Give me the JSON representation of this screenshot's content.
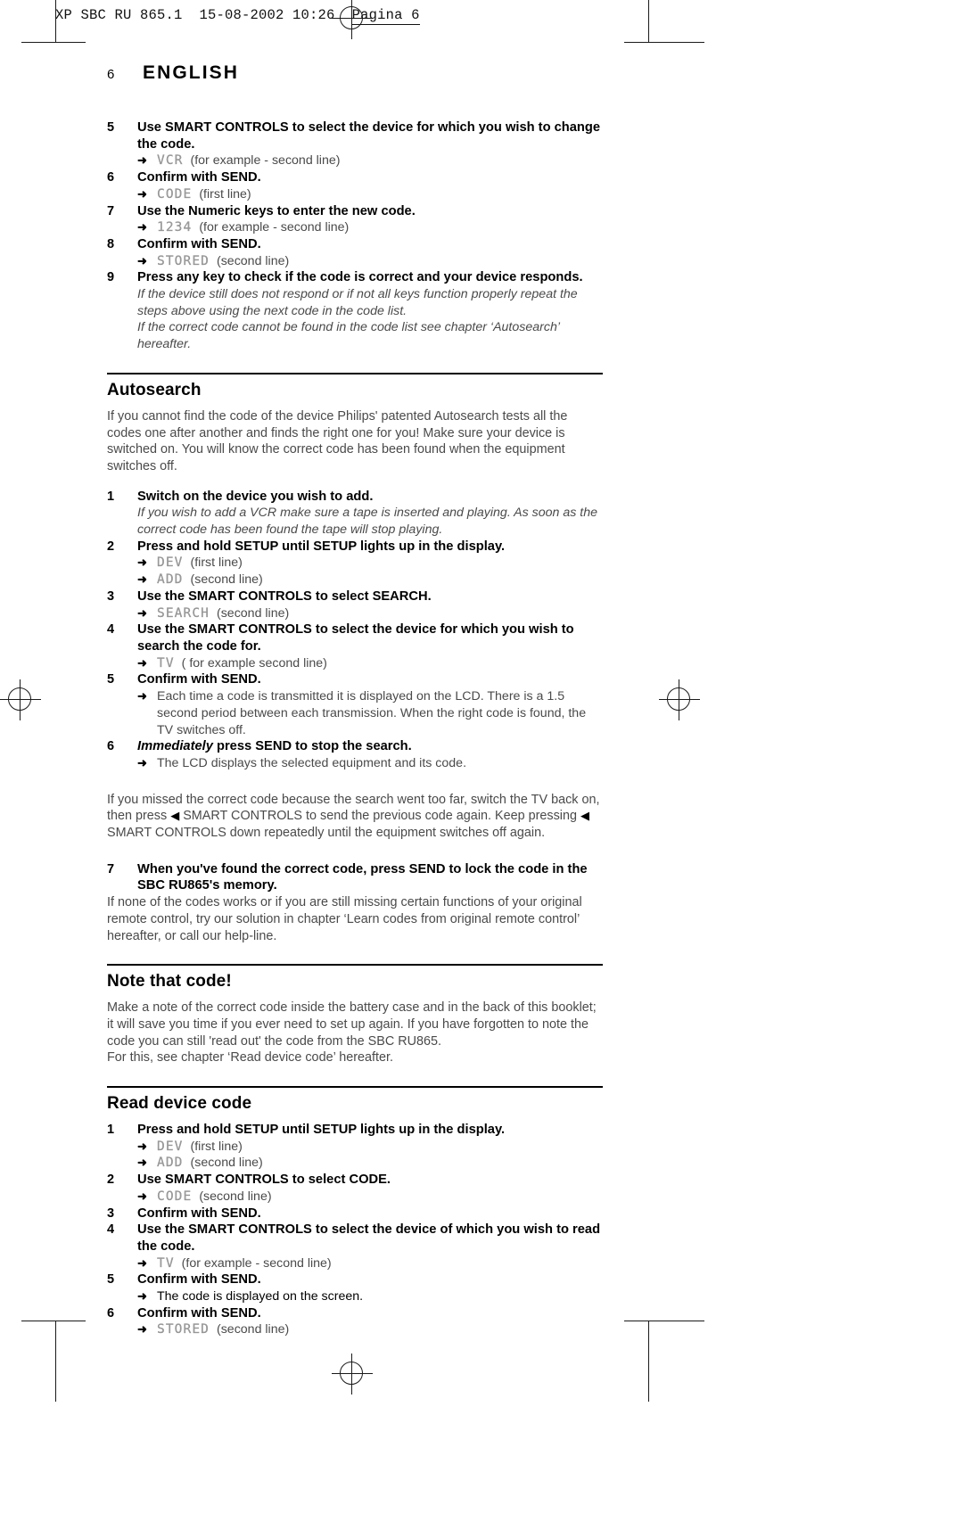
{
  "film_header": {
    "prefix": "XP SBC RU 865.1  15-08-2002 10:26",
    "page_label": "Pagina 6"
  },
  "page_header": {
    "folio": "6",
    "language": "ENGLISH"
  },
  "icons": {
    "arrow_right": "➜",
    "triangle_left": "◀"
  },
  "top_steps": [
    {
      "num": "5",
      "text": "Use SMART CONTROLS to select the device for which you wish to change the code.",
      "subs": [
        {
          "lcd": "VCR",
          "note": "(for example - second line)"
        }
      ]
    },
    {
      "num": "6",
      "text": "Confirm with SEND.",
      "subs": [
        {
          "lcd": "CODE",
          "note": "(first line)"
        }
      ]
    },
    {
      "num": "7",
      "text": "Use the Numeric keys to enter the new code.",
      "subs": [
        {
          "lcd": "1234",
          "note": "(for example - second line)"
        }
      ]
    },
    {
      "num": "8",
      "text": "Confirm with SEND.",
      "subs": [
        {
          "lcd": "STORED",
          "note": "(second line)"
        }
      ]
    },
    {
      "num": "9",
      "text": "Press any key to check if the code is correct and your device responds.",
      "remarks": [
        "If the device still does not respond or if not all keys function properly repeat the steps above using the next code in the code list.",
        "If the correct code cannot be found in the code list see chapter ‘Autosearch’ hereafter."
      ]
    }
  ],
  "autosearch": {
    "heading": "Autosearch",
    "intro": "If you cannot find the code of the device Philips' patented Autosearch tests all the codes one after another and finds the right one for you! Make sure your device is switched on. You will know the correct code has been found when the equipment switches off.",
    "steps": [
      {
        "num": "1",
        "text": "Switch on the device you wish to add.",
        "remarks": [
          "If you wish to add a VCR make sure a tape is inserted and playing. As soon as the correct code has been found the tape will stop playing."
        ]
      },
      {
        "num": "2",
        "text": "Press and hold SETUP until SETUP lights up in the display.",
        "subs": [
          {
            "lcd": "DEV",
            "note": "(first line)"
          },
          {
            "lcd": "ADD",
            "note": "(second line)"
          }
        ]
      },
      {
        "num": "3",
        "text": "Use the SMART CONTROLS to select SEARCH.",
        "subs": [
          {
            "lcd": "SEARCH",
            "note": "(second line)"
          }
        ]
      },
      {
        "num": "4",
        "text": "Use the SMART CONTROLS to select the device for which you wish to search the code for.",
        "subs": [
          {
            "lcd": "TV",
            "note": "( for example second line)"
          }
        ]
      },
      {
        "num": "5",
        "text": "Confirm with SEND.",
        "subs": [
          {
            "lcd": "",
            "note": "Each time a code is transmitted it is displayed on the LCD. There is a 1.5 second period between each transmission. When the right code is found, the TV switches off."
          }
        ]
      },
      {
        "num": "6",
        "text_em": "Immediately",
        "text": " press SEND to stop the search.",
        "subs": [
          {
            "lcd": "",
            "note": "The LCD displays the selected equipment and its code."
          }
        ]
      }
    ],
    "missed_para_1": "If you missed the correct code because the search went too far, switch the TV back on, then press ",
    "missed_para_2": " SMART CONTROLS to send the previous code again. Keep pressing ",
    "missed_para_3": " SMART CONTROLS down repeatedly until the equipment switches off again.",
    "final_step": {
      "num": "7",
      "text": "When you've found the correct code, press SEND to lock the code in the SBC RU865's memory."
    },
    "closing": "If none of the codes works or if you are still missing certain functions of your original remote control, try our solution in chapter ‘Learn codes from original remote control’ hereafter, or call our help-line."
  },
  "note_that_code": {
    "heading": "Note that code!",
    "para_1": "Make a note of the correct code inside the battery case and in the back of this booklet; it will save you time if you ever need to set up again. If you have forgotten to note the code you can still 'read out' the code from the SBC RU865.",
    "para_2": "For this, see chapter ‘Read device code’ hereafter."
  },
  "read_device_code": {
    "heading": "Read device code",
    "steps": [
      {
        "num": "1",
        "text": "Press and hold SETUP until SETUP lights up in the display.",
        "subs": [
          {
            "lcd": "DEV",
            "note": "(first line)"
          },
          {
            "lcd": "ADD",
            "note": "(second line)"
          }
        ]
      },
      {
        "num": "2",
        "text": "Use SMART CONTROLS to select CODE.",
        "subs": [
          {
            "lcd": "CODE",
            "note": "(second line)"
          }
        ]
      },
      {
        "num": "3",
        "text": "Confirm with SEND."
      },
      {
        "num": "4",
        "text": "Use the SMART CONTROLS to select the device of which you wish to read the code.",
        "subs": [
          {
            "lcd": "TV",
            "note": "(for example - second line)"
          }
        ]
      },
      {
        "num": "5",
        "text": "Confirm with SEND.",
        "subs": [
          {
            "lcd": "",
            "note": "The code is displayed on the screen.",
            "dark": true
          }
        ]
      },
      {
        "num": "6",
        "text": "Confirm with SEND.",
        "subs": [
          {
            "lcd": "STORED",
            "note": "(second line)"
          }
        ]
      }
    ]
  }
}
